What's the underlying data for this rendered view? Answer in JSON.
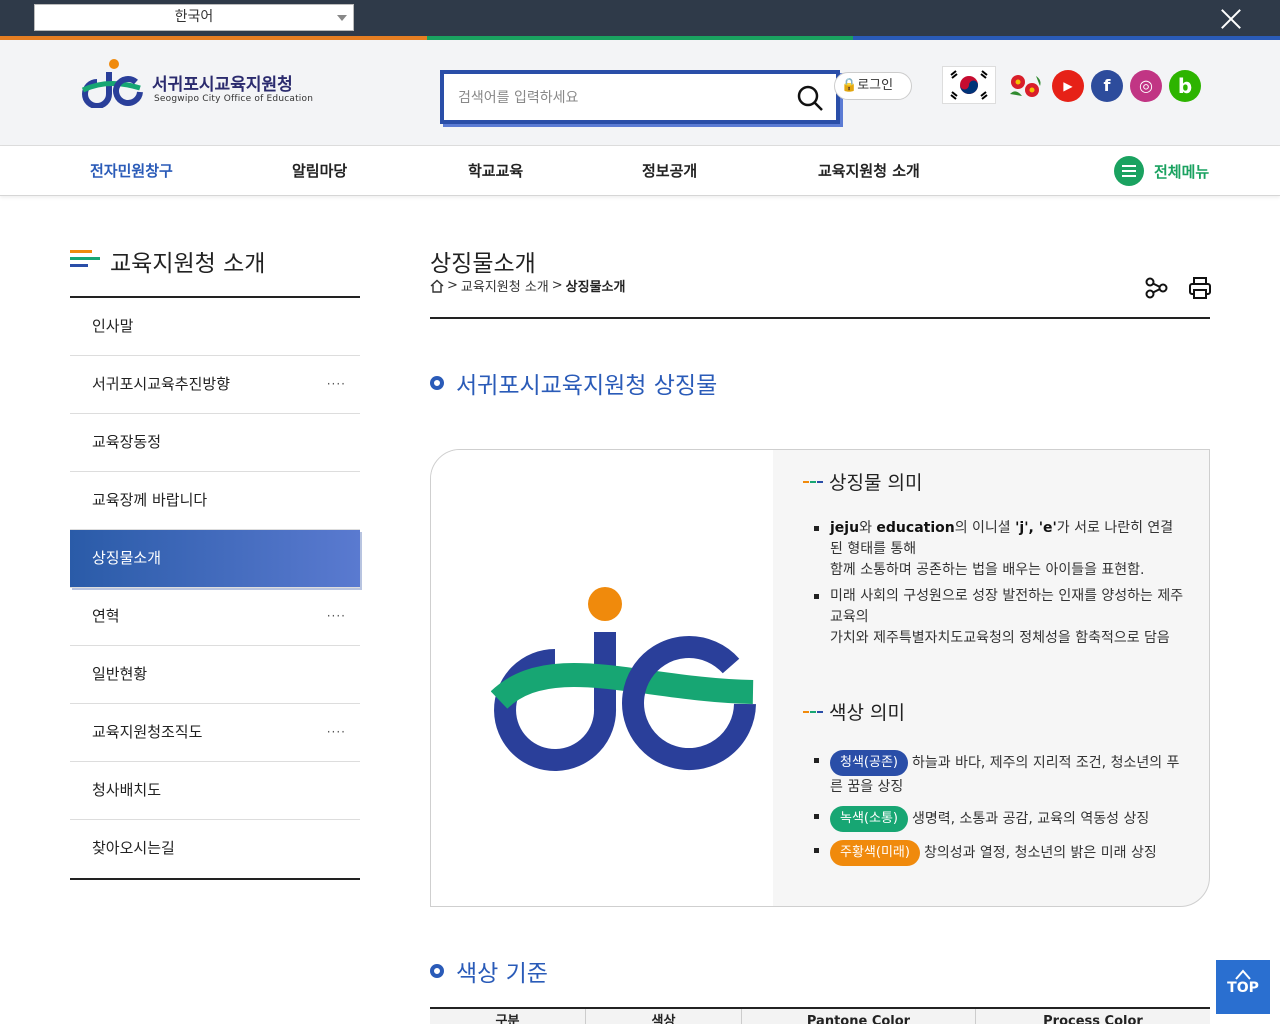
{
  "topbar": {
    "language": "한국어",
    "line_colors": [
      "#e67e22",
      "#1aa260",
      "#2a5bb8"
    ]
  },
  "header": {
    "logo_ko": "서귀포시교육지원청",
    "logo_en": "Seogwipo City Office of Education",
    "search_placeholder": "검색어를 입력하세요",
    "login": "로그인",
    "sns": [
      {
        "name": "youtube-icon",
        "label": "▶",
        "color": "#e62117"
      },
      {
        "name": "facebook-icon",
        "label": "f",
        "color": "#2d4c9c"
      },
      {
        "name": "instagram-icon",
        "label": "◎",
        "color": "#c13584"
      },
      {
        "name": "blog-icon",
        "label": "b",
        "color": "#2db400"
      }
    ]
  },
  "gnb": {
    "items": [
      "전자민원창구",
      "알림마당",
      "학교교육",
      "정보공개",
      "교육지원청 소개"
    ],
    "all_menu": "전체메뉴"
  },
  "sidebar": {
    "title": "교육지원청 소개",
    "items": [
      {
        "label": "인사말",
        "dots": ""
      },
      {
        "label": "서귀포시교육추진방향",
        "dots": "····"
      },
      {
        "label": "교육장동정",
        "dots": ""
      },
      {
        "label": "교육장께 바랍니다",
        "dots": ""
      },
      {
        "label": "상징물소개",
        "dots": ""
      },
      {
        "label": "연혁",
        "dots": "····"
      },
      {
        "label": "일반현황",
        "dots": ""
      },
      {
        "label": "교육지원청조직도",
        "dots": "····"
      },
      {
        "label": "청사배치도",
        "dots": ""
      },
      {
        "label": "찾아오시는길",
        "dots": ""
      }
    ],
    "active_index": 4
  },
  "content": {
    "page_title": "상징물소개",
    "breadcrumb": {
      "sep": ">",
      "level1": "교육지원청 소개",
      "current": "상징물소개"
    },
    "section1": "서귀포시교육지원청 상징물",
    "meaning": {
      "title": "상징물 의미",
      "b1_strong": "jeju",
      "b1_mid": "와 ",
      "b1_strong2": "education",
      "b1_mid2": "의 이니셜 ",
      "b1_strong3": "'j', 'e'",
      "b1_rest": "가 서로 나란히 연결된 형태를 통해",
      "b1_line2": "함께 소통하며 공존하는 법을 배우는 아이들을 표현함.",
      "b2": "미래 사회의 구성원으로 성장 발전하는 인재를 양성하는 제주교육의",
      "b2_line2": "가치와 제주특별자치도교육청의 정체성을 함축적으로 담음"
    },
    "color_meaning": {
      "title": "색상 의미",
      "items": [
        {
          "pill": "청색(공존)",
          "color": "#2a4ea8",
          "text": "하늘과 바다, 제주의 지리적 조건, 청소년의 푸른 꿈을 상징"
        },
        {
          "pill": "녹색(소통)",
          "color": "#17a673",
          "text": "생명력, 소통과 공감, 교육의 역동성 상징"
        },
        {
          "pill": "주황색(미래)",
          "color": "#f08a0c",
          "text": "창의성과 열정, 청소년의 밝은 미래 상징"
        }
      ]
    },
    "section2": "색상 기준",
    "table_headers": [
      "구분",
      "색상",
      "Pantone Color",
      "Process Color"
    ]
  },
  "top_button": "TOP",
  "logo_colors": {
    "blue": "#2a3f9a",
    "green": "#17a673",
    "orange": "#f08a0c"
  }
}
